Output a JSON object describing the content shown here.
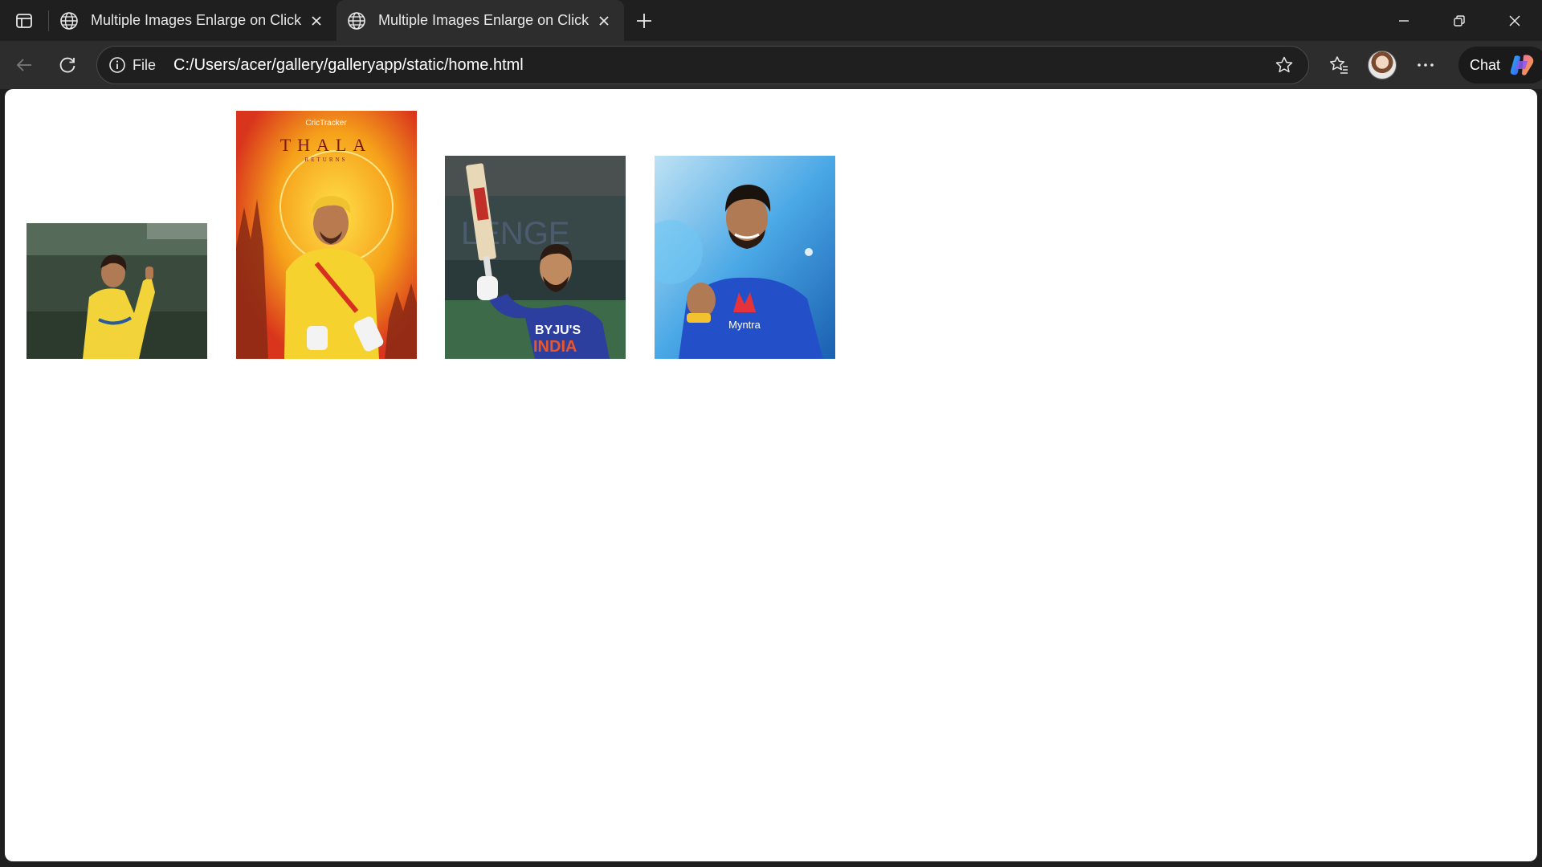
{
  "browser": {
    "tabs": [
      {
        "title": "Multiple Images Enlarge on Click",
        "active": false
      },
      {
        "title": "Multiple Images Enlarge on Click",
        "active": true
      }
    ],
    "address": {
      "scheme_label": "File",
      "url": "C:/Users/acer/gallery/galleryapp/static/home.html"
    },
    "chat_label": "Chat"
  },
  "gallery": {
    "images": [
      {
        "name": "player-image-1",
        "jersey_color": "#f2d43a",
        "background": "#3a4a3c"
      },
      {
        "name": "player-image-2",
        "jersey_color": "#f5d22e",
        "background": "#f0a01e",
        "poster_brand": "CricTracker",
        "poster_title": "THALA",
        "poster_subtitle": "RETURNS"
      },
      {
        "name": "player-image-3",
        "jersey_color": "#2c3e9e",
        "background": "#2a3a3a",
        "jersey_text": "BYJU'S INDIA"
      },
      {
        "name": "player-image-4",
        "jersey_color": "#2350c8",
        "background": "#3b8fd6",
        "jersey_text": "Myntra"
      }
    ]
  }
}
